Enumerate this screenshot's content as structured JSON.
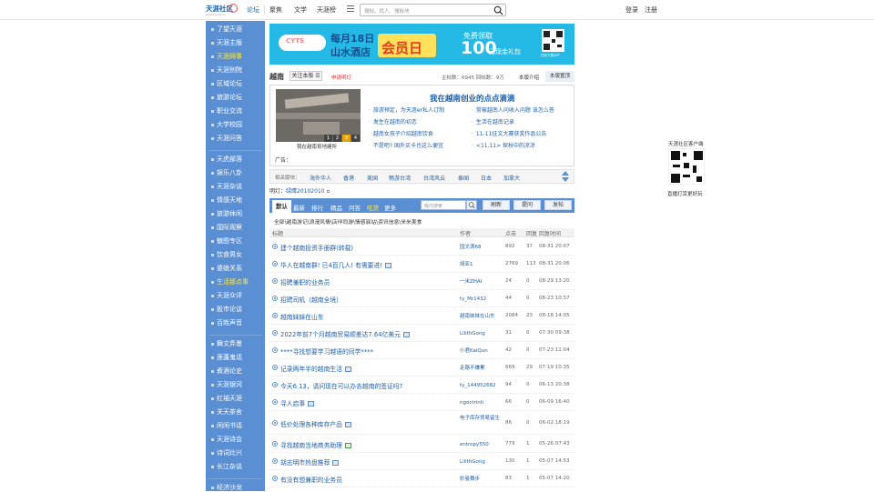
{
  "header": {
    "logo_text": "天涯社区",
    "logo_sub": "www.tianya.cn",
    "nav": [
      "论坛",
      "聚焦",
      "文学",
      "天涯榜"
    ],
    "search_placeholder": "搜帖、找人、搜板块",
    "login": "登录",
    "register": "注册"
  },
  "sidebar": {
    "items": [
      {
        "label": "了望天涯",
        "hl": false
      },
      {
        "label": "天涯主版",
        "hl": false
      },
      {
        "label": "天涯网事",
        "hl": true
      },
      {
        "label": "天涯别院",
        "hl": false
      },
      {
        "label": "区域论坛",
        "hl": false
      },
      {
        "label": "旅游论坛",
        "hl": false
      },
      {
        "label": "职业交流",
        "hl": false
      },
      {
        "label": "大学校园",
        "hl": false
      },
      {
        "label": "天涯问答",
        "hl": false
      },
      {
        "label": "天虎部落",
        "hl": false
      },
      {
        "label": "娱乐八卦",
        "hl": false
      },
      {
        "label": "天涯杂谈",
        "hl": false
      },
      {
        "label": "情感天地",
        "hl": false
      },
      {
        "label": "旅游休闲",
        "hl": false
      },
      {
        "label": "国际观察",
        "hl": false
      },
      {
        "label": "魅图专区",
        "hl": false
      },
      {
        "label": "饮食男女",
        "hl": false
      },
      {
        "label": "婆媳关系",
        "hl": false
      },
      {
        "label": "生活那点事",
        "hl": true
      },
      {
        "label": "天涯众评",
        "hl": false
      },
      {
        "label": "股市论谈",
        "hl": false
      },
      {
        "label": "百姓声音",
        "hl": false
      },
      {
        "label": "舞文弄墨",
        "hl": false
      },
      {
        "label": "莲蓬鬼话",
        "hl": false
      },
      {
        "label": "煮酒论史",
        "hl": false
      },
      {
        "label": "天涯银河",
        "hl": false
      },
      {
        "label": "红袖天涯",
        "hl": false
      },
      {
        "label": "关天茶舍",
        "hl": false
      },
      {
        "label": "闲闲书话",
        "hl": false
      },
      {
        "label": "天涯诗会",
        "hl": false
      },
      {
        "label": "诗词比兴",
        "hl": false
      },
      {
        "label": "长江杂谈",
        "hl": false
      },
      {
        "label": "经济沙龙",
        "hl": false
      }
    ]
  },
  "banner": {
    "logo": "CYTS",
    "line1": "每月18日",
    "line2": "山水酒店",
    "badge": "会员日",
    "free": "免费领取",
    "big": "100",
    "gift": "元现金礼包",
    "qr_caption": "扫码下载APP"
  },
  "board": {
    "name": "越南",
    "follow": "关注本版",
    "apply": "申请明灯",
    "stats": "主帖数：6945  回帖数：9万",
    "intro": "本版介绍",
    "hot": "本版置顶"
  },
  "feature": {
    "title": "我在越南创业的点点滴滴",
    "caption": "我在越南育地建所",
    "pages": [
      "1",
      "2",
      "3",
      "4"
    ],
    "links": [
      "旅游预定，为天涯er私人订制",
      "常被越南人问收入问题 该怎么答",
      "发生在越南的初恋",
      "生活在越南记录",
      "越南女孩子介绍越南饮食",
      "11-11征文大赛获奖作品公告",
      "不是吧? 国外买卡也这么便宜",
      "<11.11> 探秋中的凉凉"
    ],
    "ad_label": "广告："
  },
  "related": {
    "label": "相关版块：",
    "items": [
      "海外华人",
      "香港",
      "美国",
      "畅游台湾",
      "台湾风云",
      "泰国",
      "日本",
      "加拿大"
    ]
  },
  "moderator": {
    "label": "明灯：",
    "name": "绿鹰20102010"
  },
  "tabs": {
    "items": [
      "默认",
      "最新",
      "排行",
      "精品",
      "问答",
      "吃货",
      "更多"
    ],
    "search_placeholder": "版内搜索",
    "refresh": "刷新",
    "ask": "提问",
    "post": "发帖"
  },
  "categories": "全部\\越南游记\\浪漫风情\\店伴同游\\情感驿站\\资讯信息\\米米美食",
  "table": {
    "headers": [
      "标题",
      "作者",
      "点击",
      "回复",
      "回复时间"
    ],
    "rows": [
      {
        "title": "建个越南投资手册群(转载)",
        "author": "园文滴68",
        "clicks": "892",
        "replies": "37",
        "time": "08-31 20:07",
        "pic": ""
      },
      {
        "title": "华人在越南群! 已4百几人! 有需要进!",
        "author": "胡亚1",
        "clicks": "2769",
        "replies": "113",
        "time": "08-31 20:06",
        "pic": "b"
      },
      {
        "title": "招聘兼职的业务员",
        "author": "一米ZHAI",
        "clicks": "24",
        "replies": "0",
        "time": "08-29 13:20",
        "pic": ""
      },
      {
        "title": "招聘司机（越南全境）",
        "author": "ty_Mr1432",
        "clicks": "44",
        "replies": "0",
        "time": "08-23 10:57",
        "pic": ""
      },
      {
        "title": "越南妹妹在山东",
        "author": "越南妹妹在山东",
        "clicks": "2084",
        "replies": "23",
        "time": "08-18 14:05",
        "pic": ""
      },
      {
        "title": "2022年前7个月越南贸易顺差达7.64亿美元",
        "author": "LilithGong",
        "clicks": "31",
        "replies": "0",
        "time": "07-30 09:38",
        "pic": "b"
      },
      {
        "title": "****寻找想要学习越语的同学****",
        "author": "小君KaiQun",
        "clicks": "42",
        "replies": "0",
        "time": "07-23 11:04",
        "pic": ""
      },
      {
        "title": "记录两年半的越南生活",
        "author": "走路不嫌累",
        "clicks": "669",
        "replies": "29",
        "time": "07-19 10:35",
        "pic": "b"
      },
      {
        "title": "今天6.13，请问现在可以办去越南的签证吗?",
        "author": "ty_144952682",
        "clicks": "94",
        "replies": "0",
        "time": "06-13 20:38",
        "pic": ""
      },
      {
        "title": "寻人启事",
        "author": "ngoctrinh",
        "clicks": "66",
        "replies": "0",
        "time": "06-09 16:40",
        "pic": "b"
      },
      {
        "title": "低价处理各种库存产品",
        "author": "电子库存贸易留生",
        "clicks": "86",
        "replies": "0",
        "time": "06-02 18:19",
        "pic": "b"
      },
      {
        "title": "寻找越南当地商务助理",
        "author": "entropy550",
        "clicks": "779",
        "replies": "1",
        "time": "05-26 07:43",
        "pic": "g"
      },
      {
        "title": "胡志明市热盘推荐",
        "author": "LilithGong",
        "clicks": "130",
        "replies": "1",
        "time": "05-07 14:53",
        "pic": "b"
      },
      {
        "title": "有没有想兼职的业务员",
        "author": "妙曼舞步",
        "clicks": "83",
        "replies": "1",
        "time": "05-07 14:20",
        "pic": ""
      }
    ]
  },
  "qr_widget": {
    "title": "天涯社区客户端",
    "caption": "直播打赏更好玩"
  },
  "colors": {
    "sidebar": "#5b8fd3",
    "link": "#1f5fa8",
    "highlight": "#ffea52",
    "banner": "#25b9e6"
  }
}
